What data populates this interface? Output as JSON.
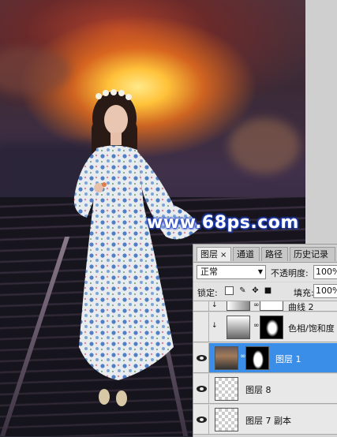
{
  "watermark": "www.68ps.com",
  "layers_panel": {
    "tabs": [
      {
        "label": "图层",
        "close": "×"
      },
      {
        "label": "通道"
      },
      {
        "label": "路径"
      },
      {
        "label": "历史记录"
      }
    ],
    "blend_mode": "正常",
    "opacity_label": "不透明度:",
    "opacity_value": "100%",
    "lock_label": "锁定:",
    "fill_label": "填充:",
    "fill_value": "100%",
    "layers": [
      {
        "name": "曲线 2",
        "visible": false,
        "selected": false
      },
      {
        "name": "色相/饱和度",
        "visible": false,
        "selected": false
      },
      {
        "name": "图层 1",
        "visible": true,
        "selected": true
      },
      {
        "name": "图层 8",
        "visible": true,
        "selected": false
      },
      {
        "name": "图层 7 副本",
        "visible": true,
        "selected": false
      }
    ]
  }
}
